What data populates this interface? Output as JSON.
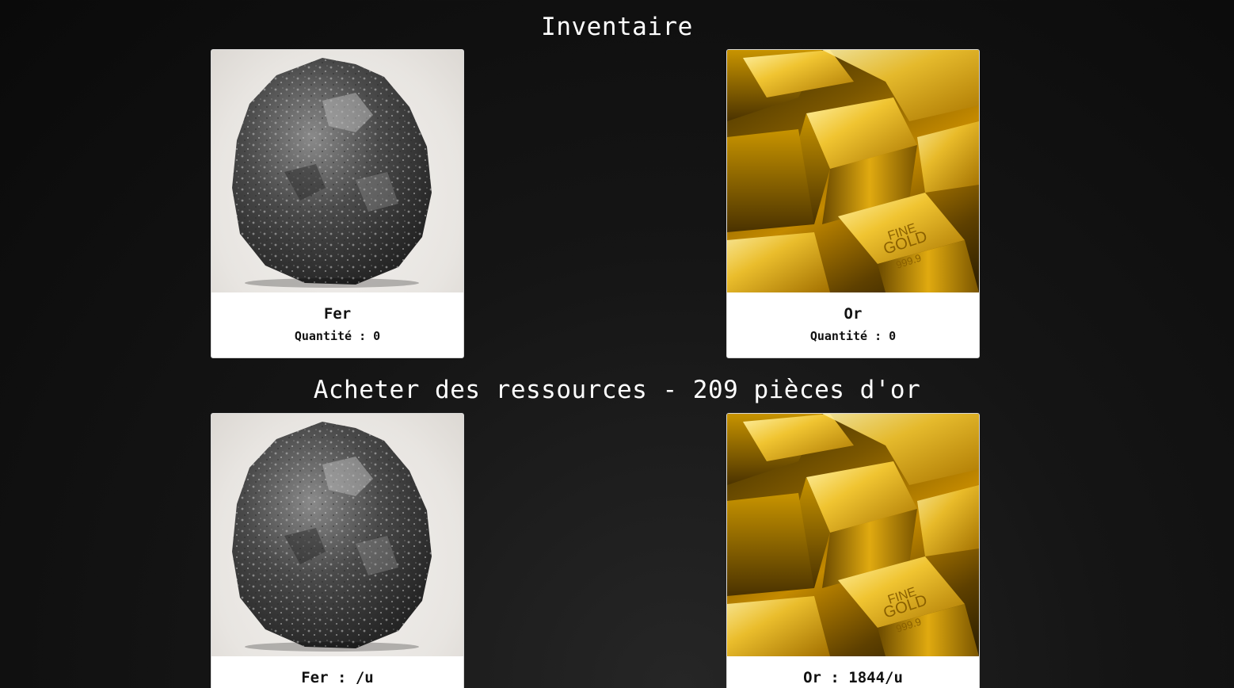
{
  "inventory": {
    "title": "Inventaire",
    "items": [
      {
        "name": "Fer",
        "quantity_text": "Quantité : 0",
        "image": "iron-ore-image"
      },
      {
        "name": "Or",
        "quantity_text": "Quantité : 0",
        "image": "gold-bars-image"
      }
    ]
  },
  "shop": {
    "title": "Acheter des ressources - 209 pièces d'or",
    "items": [
      {
        "label": "Fer : /u",
        "image": "iron-ore-image"
      },
      {
        "label": "Or : 1844/u",
        "image": "gold-bars-image"
      }
    ]
  },
  "colors": {
    "background": "#0d0d0d",
    "card_background": "#ffffff",
    "title_text": "#ffffff",
    "gold": "#d4a000"
  }
}
